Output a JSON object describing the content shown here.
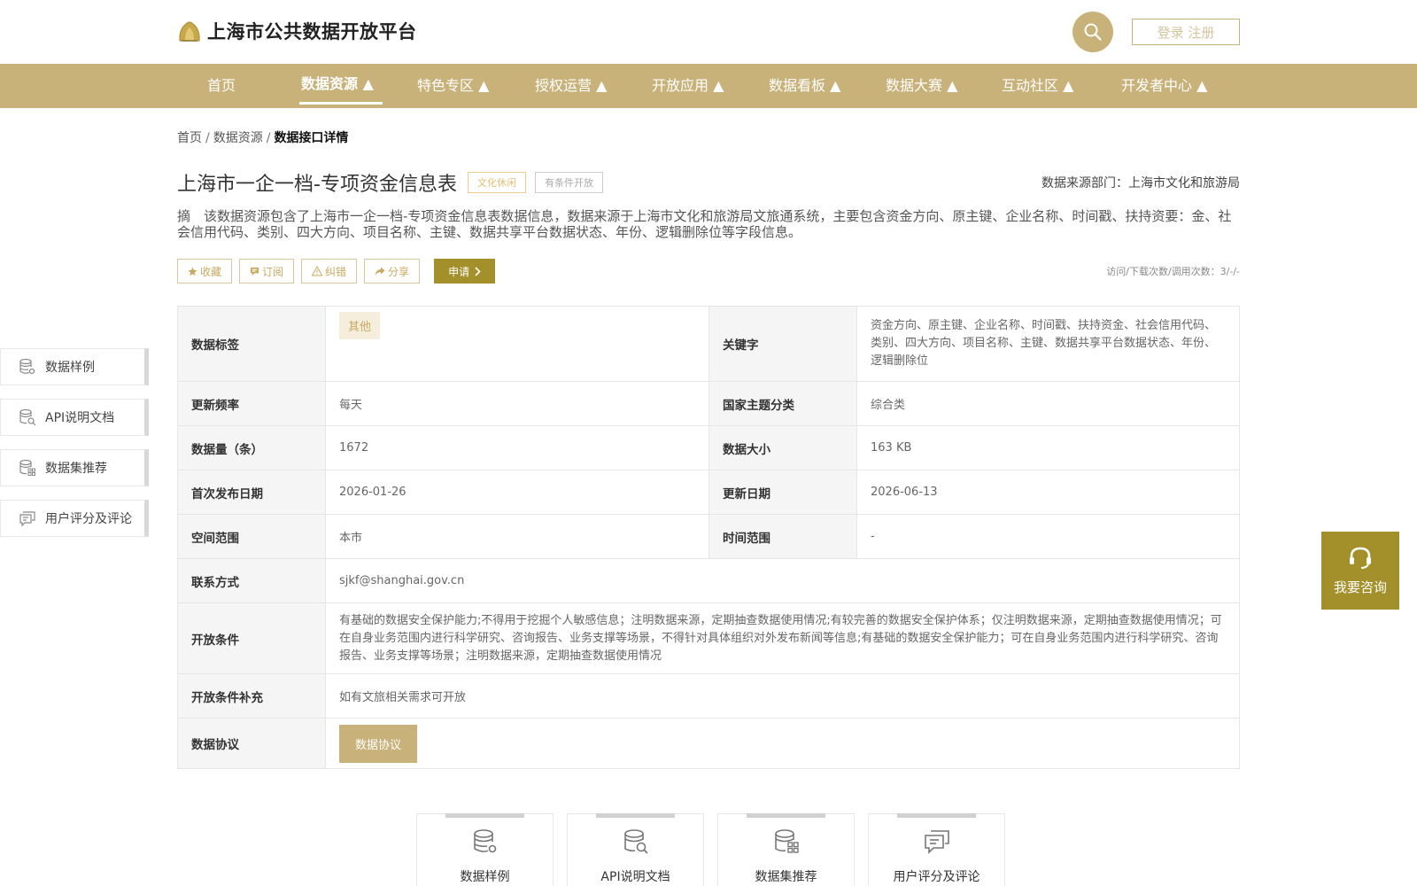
{
  "header": {
    "site_title": "上海市公共数据开放平台",
    "login_label": "登录 注册"
  },
  "nav": {
    "items": [
      {
        "label": "首页"
      },
      {
        "label": "数据资源 ▲"
      },
      {
        "label": "特色专区 ▲"
      },
      {
        "label": "授权运营 ▲"
      },
      {
        "label": "开放应用 ▲"
      },
      {
        "label": "数据看板 ▲"
      },
      {
        "label": "数据大赛 ▲"
      },
      {
        "label": "互动社区 ▲"
      },
      {
        "label": "开发者中心 ▲"
      }
    ],
    "active_index": 1
  },
  "breadcrumb": {
    "home": "首页",
    "section": "数据资源",
    "current": "数据接口详情",
    "separator": "/"
  },
  "dataset": {
    "title": "上海市一企一档-专项资金信息表",
    "tag_category": "文化休闲",
    "tag_openness": "有条件开放",
    "source": "数据来源部门：上海市文化和旅游局",
    "summary": "摘　该数据资源包含了上海市一企一档-专项资金信息表数据信息，数据来源于上海市文化和旅游局文旅通系统，主要包含资金方向、原主键、企业名称、时间戳、扶持资要：金、社会信用代码、类别、四大方向、项目名称、主键、数据共享平台数据状态、年份、逻辑删除位等字段信息。"
  },
  "actions": {
    "collect": "收藏",
    "subscribe": "订阅",
    "report": "纠错",
    "share": "分享",
    "apply": "申请",
    "visits": "访问/下载次数/调用次数：3/-/-"
  },
  "details": {
    "tags_key": "数据标签",
    "tags_value": "其他",
    "keywords_key": "关键字",
    "keywords_value": "资金方向、原主键、企业名称、时间戳、扶持资金、社会信用代码、类别、四大方向、项目名称、主键、数据共享平台数据状态、年份、逻辑删除位",
    "freq_key": "更新频率",
    "freq_value": "每天",
    "theme_key": "国家主题分类",
    "theme_value": "综合类",
    "count_key": "数据量（条）",
    "count_value": "1672",
    "size_key": "数据大小",
    "size_value": "163 KB",
    "first_key": "首次发布日期",
    "first_value": "2026-01-26",
    "update_key": "更新日期",
    "update_value": "2026-06-13",
    "space_key": "空间范围",
    "space_value": "本市",
    "time_key": "时间范围",
    "time_value": "-",
    "contact_key": "联系方式",
    "contact_value": "sjkf@shanghai.gov.cn",
    "cond_key": "开放条件",
    "cond_value": "有基础的数据安全保护能力;不得用于挖掘个人敏感信息；注明数据来源，定期抽查数据使用情况;有较完善的数据安全保护体系；仅注明数据来源，定期抽查数据使用情况；可在自身业务范围内进行科学研究、咨询报告、业务支撑等场景，不得针对具体组织对外发布新闻等信息;有基础的数据安全保护能力；可在自身业务范围内进行科学研究、咨询报告、业务支撑等场景；注明数据来源，定期抽查数据使用情况",
    "cond_sup_key": "开放条件补充",
    "cond_sup_value": "如有文旅相关需求可开放",
    "protocol_key": "数据协议",
    "protocol_button": "数据协议"
  },
  "side_menu": {
    "sample": "数据样例",
    "api_doc": "API说明文档",
    "recommend": "数据集推荐",
    "rating": "用户评分及评论"
  },
  "consult": {
    "label": "我要咨询"
  },
  "bottom_cards": {
    "sample": "数据样例",
    "api_doc": "API说明文档",
    "recommend": "数据集推荐",
    "rating": "用户评分及评论"
  },
  "colors": {
    "brand": "#c8b27a",
    "accent_dark": "#a3902a",
    "chip_bg": "#f6eedd"
  },
  "icons": [
    "logo-icon",
    "search-icon",
    "star-icon",
    "bookmark-icon",
    "warning-icon",
    "share-icon",
    "chevron-right-icon",
    "database-settings-icon",
    "database-search-icon",
    "database-grid-icon",
    "comment-icon",
    "headset-icon"
  ]
}
